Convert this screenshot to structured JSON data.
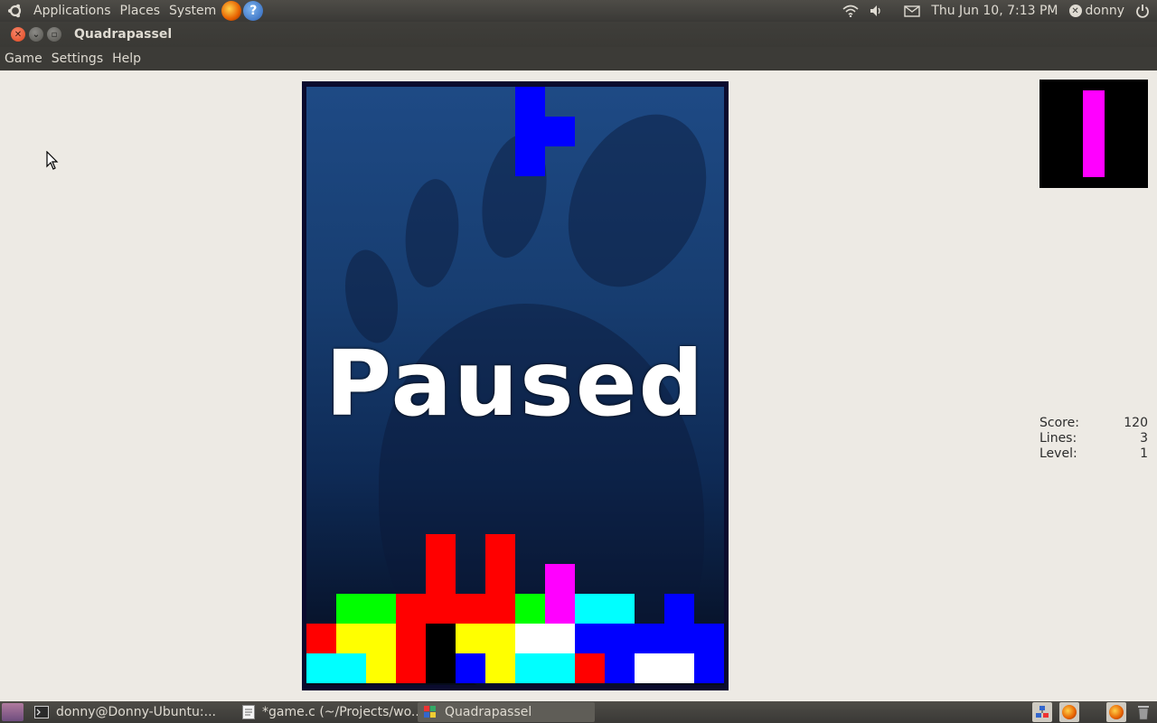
{
  "top_panel": {
    "menus": [
      "Applications",
      "Places",
      "System"
    ],
    "launchers": [
      {
        "icon": "firefox-icon"
      },
      {
        "icon": "help-icon",
        "glyph": "?"
      }
    ],
    "clock": "Thu Jun 10,  7:13 PM",
    "user": "donny"
  },
  "window": {
    "title": "Quadrapassel",
    "menus": [
      "Game",
      "Settings",
      "Help"
    ]
  },
  "game": {
    "overlay_text": "Paused",
    "falling_piece": {
      "color": "#0000ff",
      "cells": [
        [
          7,
          0
        ],
        [
          7,
          1
        ],
        [
          8,
          1
        ],
        [
          7,
          2
        ]
      ]
    },
    "board_cells": [
      {
        "c": 4,
        "r": 15,
        "color": "#ff0000"
      },
      {
        "c": 6,
        "r": 15,
        "color": "#ff0000"
      },
      {
        "c": 8,
        "r": 16,
        "color": "#ff00ff"
      },
      {
        "c": 1,
        "r": 17,
        "color": "#00ff00"
      },
      {
        "c": 2,
        "r": 17,
        "color": "#00ff00"
      },
      {
        "c": 3,
        "r": 17,
        "color": "#ff0000"
      },
      {
        "c": 4,
        "r": 17,
        "color": "#ff0000"
      },
      {
        "c": 5,
        "r": 17,
        "color": "#ff0000"
      },
      {
        "c": 6,
        "r": 17,
        "color": "#ff0000"
      },
      {
        "c": 7,
        "r": 17,
        "color": "#00ff00"
      },
      {
        "c": 8,
        "r": 17,
        "color": "#ff00ff"
      },
      {
        "c": 9,
        "r": 17,
        "color": "#00ffff"
      },
      {
        "c": 10,
        "r": 17,
        "color": "#00ffff"
      },
      {
        "c": 12,
        "r": 17,
        "color": "#0000ff"
      },
      {
        "c": 4,
        "r": 16,
        "color": "#ff0000"
      },
      {
        "c": 6,
        "r": 16,
        "color": "#ff0000"
      },
      {
        "c": 0,
        "r": 18,
        "color": "#ff0000"
      },
      {
        "c": 1,
        "r": 18,
        "color": "#ffff00"
      },
      {
        "c": 2,
        "r": 18,
        "color": "#ffff00"
      },
      {
        "c": 3,
        "r": 18,
        "color": "#ff0000"
      },
      {
        "c": 4,
        "r": 18,
        "color": "#000000"
      },
      {
        "c": 5,
        "r": 18,
        "color": "#ffff00"
      },
      {
        "c": 6,
        "r": 18,
        "color": "#ffff00"
      },
      {
        "c": 7,
        "r": 18,
        "color": "#ffffff"
      },
      {
        "c": 8,
        "r": 18,
        "color": "#ffffff"
      },
      {
        "c": 9,
        "r": 18,
        "color": "#0000ff"
      },
      {
        "c": 10,
        "r": 18,
        "color": "#0000ff"
      },
      {
        "c": 11,
        "r": 18,
        "color": "#0000ff"
      },
      {
        "c": 12,
        "r": 18,
        "color": "#0000ff"
      },
      {
        "c": 13,
        "r": 18,
        "color": "#0000ff"
      },
      {
        "c": 0,
        "r": 19,
        "color": "#00ffff"
      },
      {
        "c": 1,
        "r": 19,
        "color": "#00ffff"
      },
      {
        "c": 2,
        "r": 19,
        "color": "#ffff00"
      },
      {
        "c": 3,
        "r": 19,
        "color": "#ff0000"
      },
      {
        "c": 4,
        "r": 19,
        "color": "#000000"
      },
      {
        "c": 5,
        "r": 19,
        "color": "#0000ff"
      },
      {
        "c": 6,
        "r": 19,
        "color": "#ffff00"
      },
      {
        "c": 7,
        "r": 19,
        "color": "#00ffff"
      },
      {
        "c": 8,
        "r": 19,
        "color": "#00ffff"
      },
      {
        "c": 9,
        "r": 19,
        "color": "#ff0000"
      },
      {
        "c": 10,
        "r": 19,
        "color": "#0000ff"
      },
      {
        "c": 11,
        "r": 19,
        "color": "#ffffff"
      },
      {
        "c": 12,
        "r": 19,
        "color": "#ffffff"
      },
      {
        "c": 13,
        "r": 19,
        "color": "#0000ff"
      }
    ],
    "next_piece": {
      "color": "#ff00ff",
      "cells": 4
    },
    "stats": {
      "score_label": "Score:",
      "score": "120",
      "lines_label": "Lines:",
      "lines": "3",
      "level_label": "Level:",
      "level": "1"
    }
  },
  "taskbar": {
    "tasks": [
      {
        "icon": "terminal-icon",
        "label": "donny@Donny-Ubuntu:..."
      },
      {
        "icon": "text-editor-icon",
        "label": "*game.c (~/Projects/wo..."
      },
      {
        "icon": "quadrapassel-icon",
        "label": "Quadrapassel",
        "active": true
      }
    ]
  }
}
